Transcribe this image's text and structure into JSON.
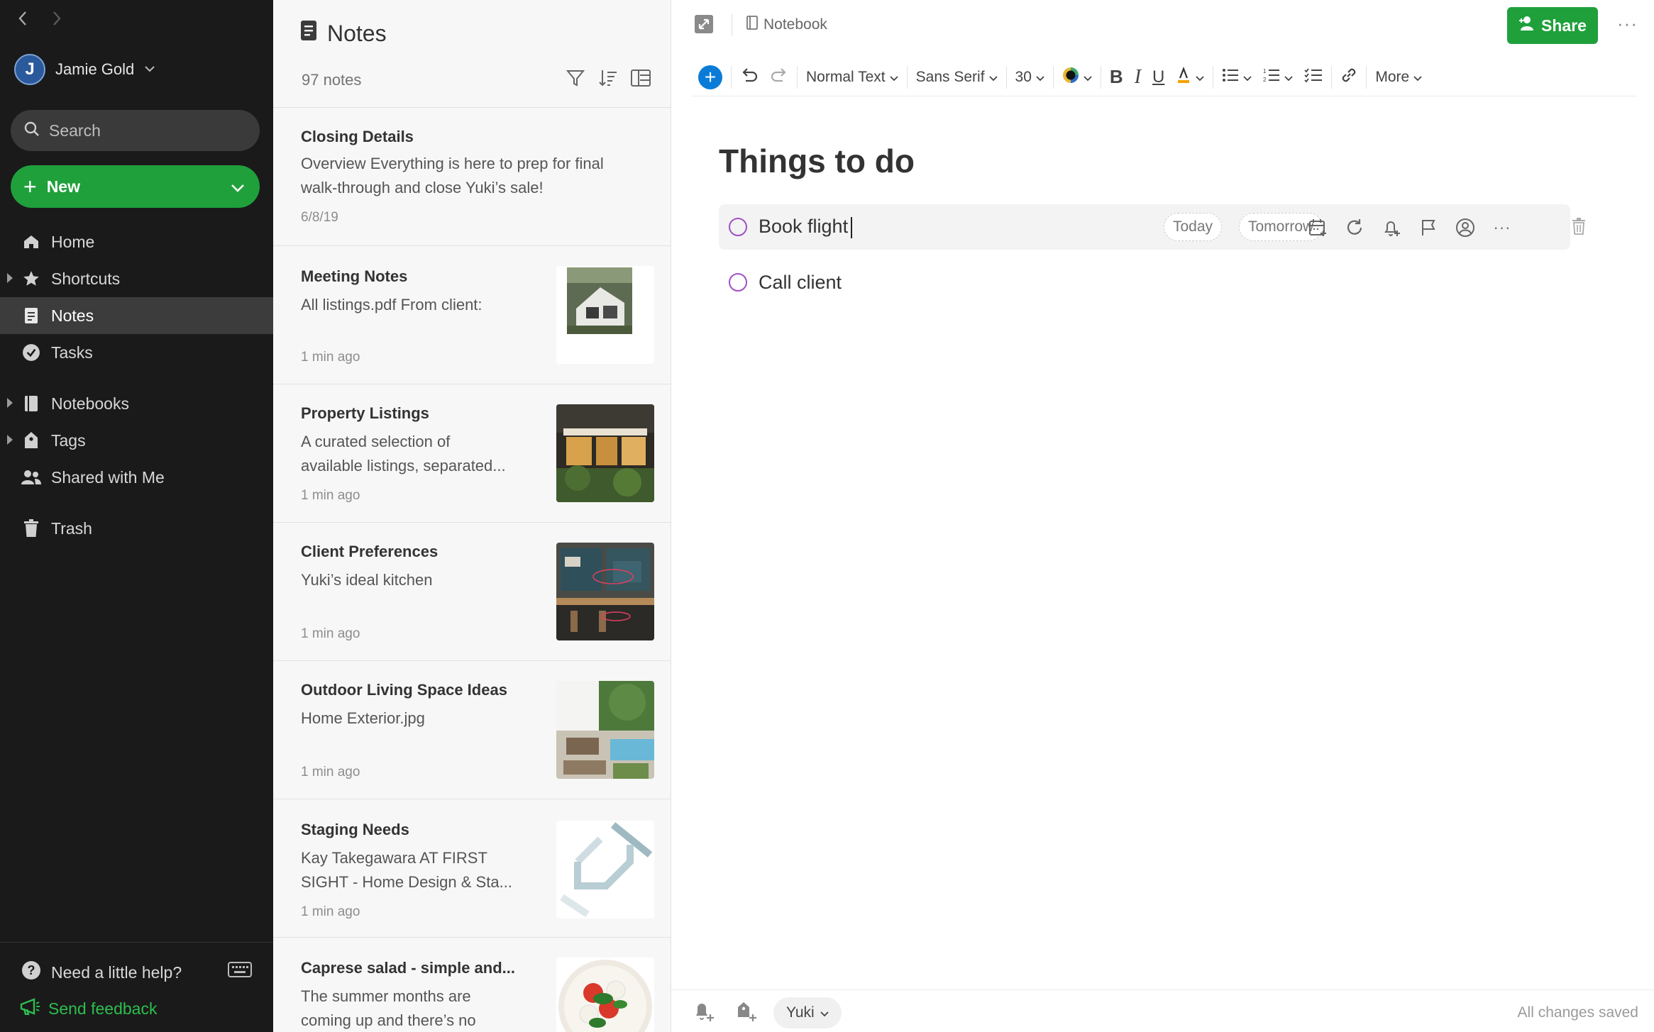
{
  "sidebar": {
    "user_name": "Jamie Gold",
    "user_initial": "J",
    "search_placeholder": "Search",
    "new_label": "New",
    "nav": {
      "home": "Home",
      "shortcuts": "Shortcuts",
      "notes": "Notes",
      "tasks": "Tasks",
      "notebooks": "Notebooks",
      "tags": "Tags",
      "shared": "Shared with Me",
      "trash": "Trash"
    },
    "help_label": "Need a little help?",
    "feedback_label": "Send feedback",
    "accent": "#1fa03b"
  },
  "notelist": {
    "title": "Notes",
    "count": "97 notes",
    "notes": [
      {
        "title": "Closing Details",
        "snippet1": "Overview Everything is here to prep for final",
        "snippet2": "walk-through and close Yuki’s sale!",
        "date": "6/8/19"
      },
      {
        "title": "Meeting Notes",
        "snippet1": "All listings.pdf From client:",
        "snippet2": "",
        "date": "1 min ago"
      },
      {
        "title": "Property Listings",
        "snippet1": "A curated selection of",
        "snippet2": "available listings, separated...",
        "date": "1 min ago"
      },
      {
        "title": "Client Preferences",
        "snippet1": "Yuki’s ideal kitchen",
        "snippet2": "",
        "date": "1 min ago"
      },
      {
        "title": "Outdoor Living Space Ideas",
        "snippet1": "Home Exterior.jpg",
        "snippet2": "",
        "date": "1 min ago"
      },
      {
        "title": "Staging Needs",
        "snippet1": "Kay Takegawara AT FIRST",
        "snippet2": "SIGHT - Home Design & Sta...",
        "date": "1 min ago"
      },
      {
        "title": "Caprese salad - simple and...",
        "snippet1": "The summer months are",
        "snippet2": "coming up and  there’s no",
        "date": ""
      }
    ]
  },
  "editor": {
    "notebook": "Notebook",
    "share_label": "Share",
    "toolbar": {
      "style": "Normal Text",
      "font": "Sans Serif",
      "size": "30",
      "more": "More"
    },
    "title": "Things to do",
    "tasks": [
      {
        "text": "Book flight",
        "chip_today": "Today",
        "chip_tomorrow": "Tomorrow"
      },
      {
        "text": "Call client"
      }
    ],
    "tag": "Yuki",
    "status": "All changes saved"
  }
}
